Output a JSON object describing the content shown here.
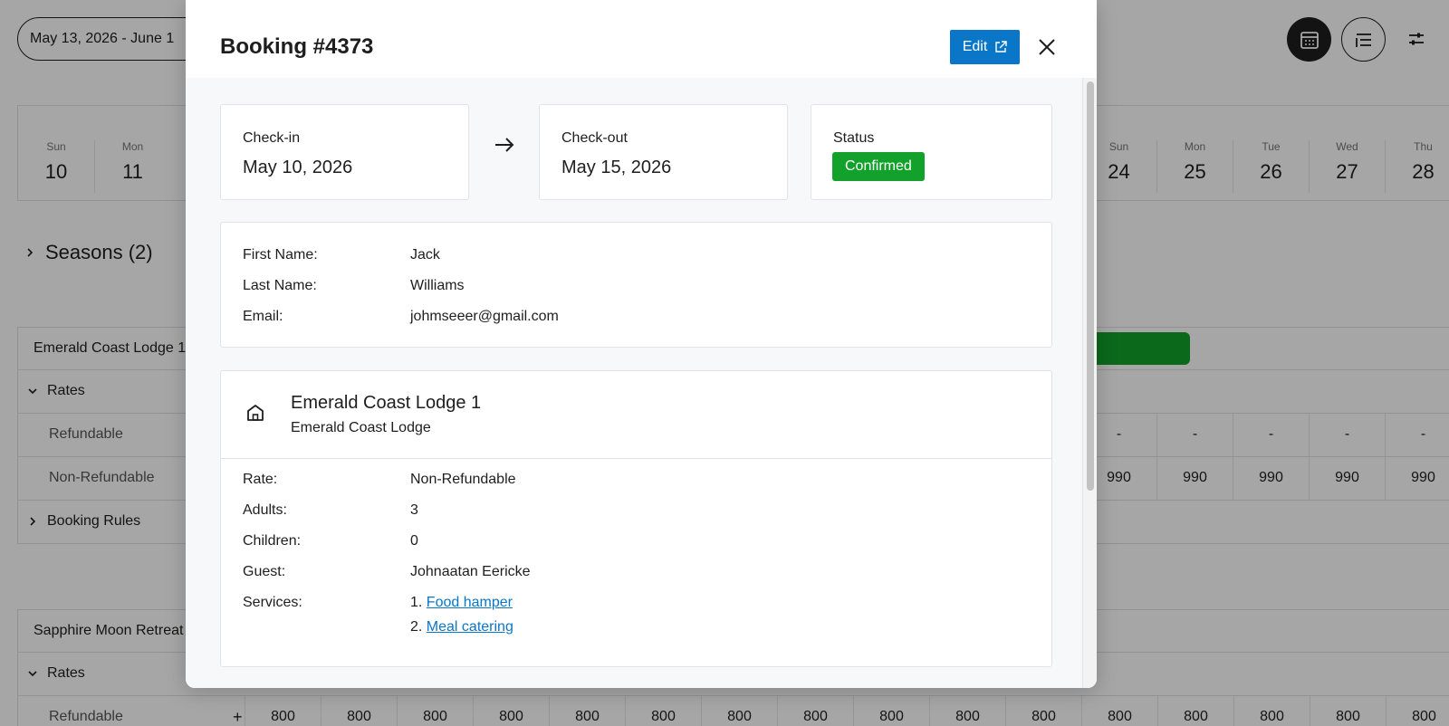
{
  "background": {
    "date_range": "May 13, 2026 - June 1",
    "days_left": [
      {
        "name": "Sun",
        "num": "10"
      },
      {
        "name": "Mon",
        "num": "11"
      }
    ],
    "days_right": [
      {
        "name": "Sun",
        "num": "24"
      },
      {
        "name": "Mon",
        "num": "25"
      },
      {
        "name": "Tue",
        "num": "26"
      },
      {
        "name": "Wed",
        "num": "27"
      },
      {
        "name": "Thu",
        "num": "28"
      }
    ],
    "seasons_label": "Seasons (2)",
    "property1": {
      "name": "Emerald Coast Lodge 1",
      "rates_label": "Rates",
      "refundable_label": "Refundable",
      "nonrefundable_label": "Non-Refundable",
      "refundable_values": [
        "-",
        "-",
        "-",
        "-",
        "-"
      ],
      "nonrefundable_values": [
        "990",
        "990",
        "990",
        "990",
        "990"
      ],
      "booking_rules_label": "Booking Rules"
    },
    "property2": {
      "name": "Sapphire Moon Retreat",
      "rates_label": "Rates",
      "refundable_label": "Refundable",
      "plus_label": "+",
      "refundable_values": [
        "800",
        "800",
        "800",
        "800",
        "800",
        "800",
        "800",
        "800",
        "800",
        "800",
        "800",
        "800",
        "800",
        "800",
        "800",
        "800"
      ]
    }
  },
  "modal": {
    "title": "Booking #4373",
    "edit_label": "Edit",
    "checkin": {
      "label": "Check-in",
      "value": "May 10, 2026"
    },
    "checkout": {
      "label": "Check-out",
      "value": "May 15, 2026"
    },
    "status": {
      "label": "Status",
      "value": "Confirmed"
    },
    "guest": {
      "first_name_label": "First Name:",
      "first_name": "Jack",
      "last_name_label": "Last Name:",
      "last_name": "Williams",
      "email_label": "Email:",
      "email": "johmseeer@gmail.com"
    },
    "property": {
      "name": "Emerald Coast Lodge 1",
      "subtitle": "Emerald Coast Lodge",
      "rate_label": "Rate:",
      "rate": "Non-Refundable",
      "adults_label": "Adults:",
      "adults": "3",
      "children_label": "Children:",
      "children": "0",
      "guest_label": "Guest:",
      "guest": "Johnaatan Eericke",
      "services_label": "Services:",
      "services": [
        {
          "prefix": "1.",
          "name": "Food hamper"
        },
        {
          "prefix": "2.",
          "name": "Meal catering"
        }
      ]
    }
  },
  "colors": {
    "accent": "#0a76c7",
    "confirmed": "#12a12a",
    "booking_bar": "#12a12a"
  },
  "icons": {
    "calendar_view": "calendar-icon",
    "list_view": "list-icon",
    "filters": "sliders-icon",
    "external_link": "external-link-icon",
    "close": "close-icon",
    "arrow": "arrow-right-icon",
    "property": "home-icon"
  }
}
